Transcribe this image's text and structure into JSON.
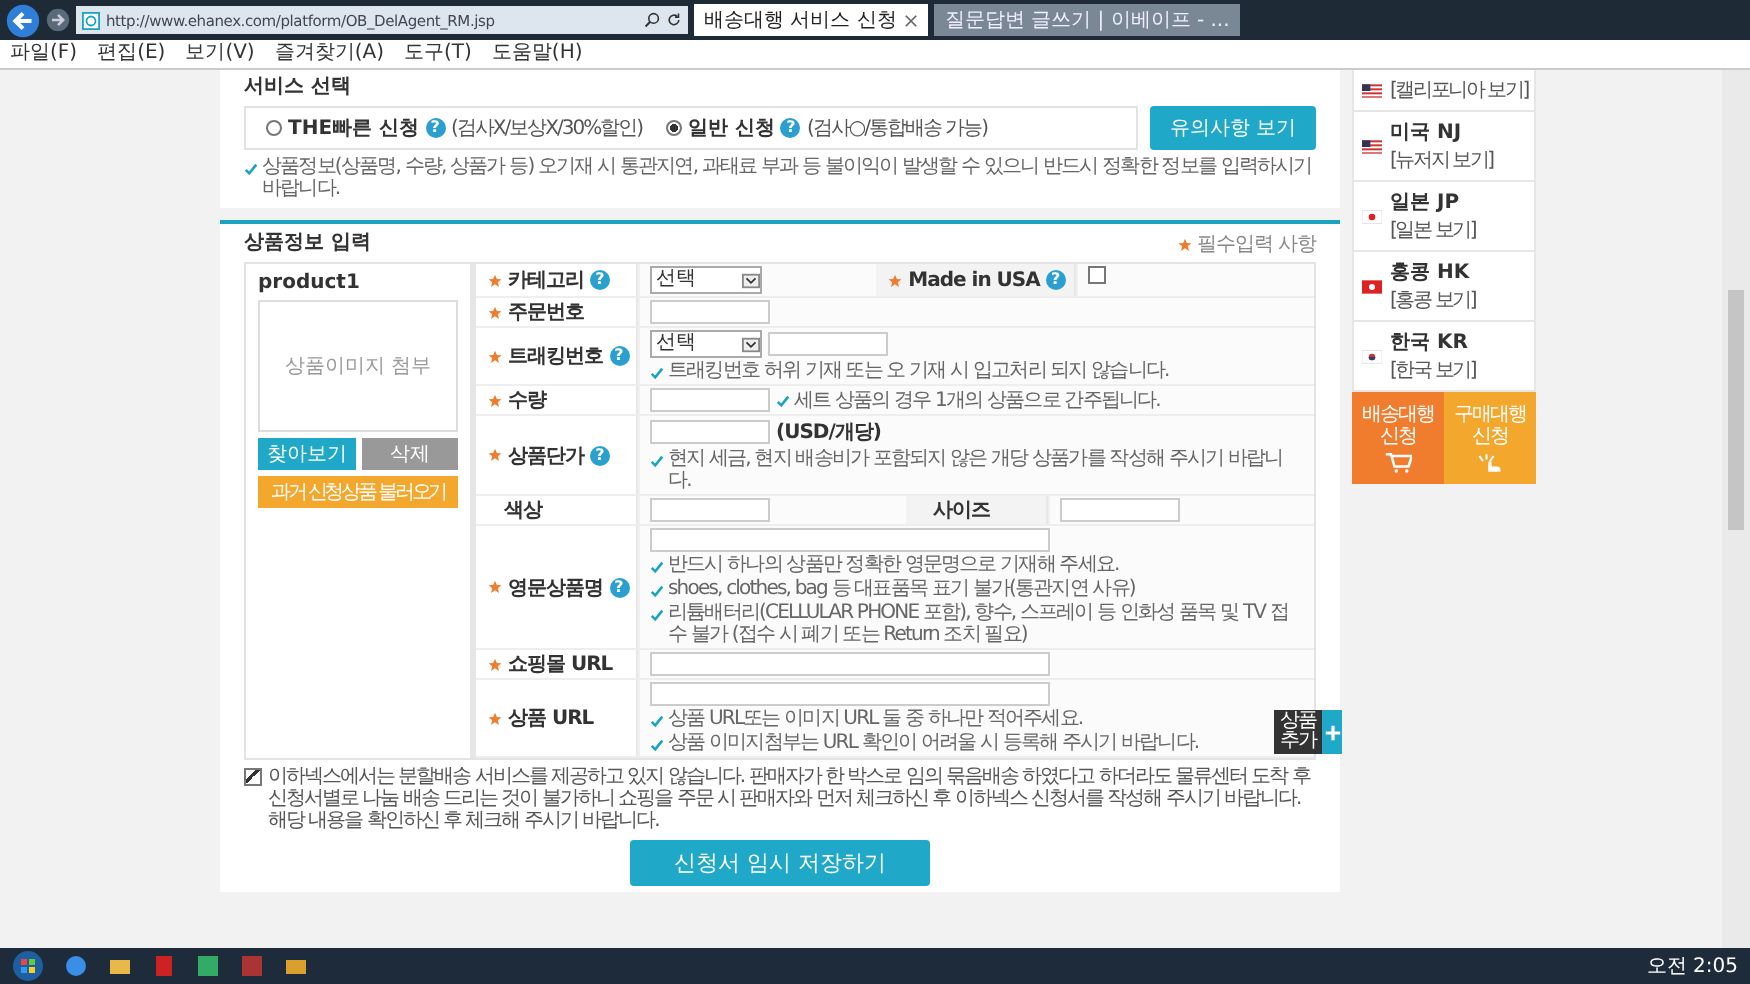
{
  "browser": {
    "address": "http://www.ehanex.com/platform/OB_DelAgent_RM.jsp",
    "tabs": [
      {
        "label": "배송대행 서비스 신청",
        "selected": true
      },
      {
        "label": "질문답변 글쓰기 | 이베이프 - ...",
        "selected": false
      }
    ],
    "menu": [
      "파일(F)",
      "편집(E)",
      "보기(V)",
      "즐겨찾기(A)",
      "도구(T)",
      "도움말(H)"
    ]
  },
  "help_glyph": "?",
  "service": {
    "title": "서비스 선택",
    "options": [
      {
        "label": "THE빠른 신청",
        "note": "(검사X/보상X/30%할인)",
        "selected": false
      },
      {
        "label": "일반 신청",
        "note": "(검사○/통합배송 가능)",
        "selected": true
      }
    ],
    "button": "유의사항 보기",
    "notice": "상품정보(상품명, 수량, 상품가 등) 오기재 시 통관지연, 과태료 부과 등 불이익이 발생할 수 있으니 반드시 정확한 정보를 입력하시기 바랍니다."
  },
  "product_section": {
    "title": "상품정보 입력",
    "required_legend": "필수입력 사항",
    "product": {
      "name": "product1",
      "image_placeholder": "상품이미지 첨부",
      "image_buttons": [
        {
          "label": "찾아보기",
          "kind": "primary"
        },
        {
          "label": "삭제",
          "kind": "secondary"
        }
      ],
      "load_button": "과거 신청상품 불러오기"
    },
    "rows": [
      {
        "fields": [
          {
            "label": "카테고리",
            "required": true,
            "help": true,
            "controls": [
              {
                "kind": "select",
                "value": "선택"
              }
            ]
          },
          {
            "label": "Made in USA",
            "required": true,
            "help": true,
            "controls": [
              {
                "kind": "checkbox",
                "checked": false
              }
            ]
          }
        ]
      },
      {
        "fields": [
          {
            "label": "주문번호",
            "required": true,
            "help": false,
            "controls": [
              {
                "kind": "input"
              }
            ]
          }
        ]
      },
      {
        "fields": [
          {
            "label": "트래킹번호",
            "required": true,
            "help": true,
            "controls": [
              {
                "kind": "select",
                "value": "선택"
              },
              {
                "kind": "input"
              }
            ],
            "notes": [
              "트래킹번호 허위 기재 또는 오 기재 시 입고처리 되지 않습니다."
            ]
          }
        ]
      },
      {
        "fields": [
          {
            "label": "수량",
            "required": true,
            "help": false,
            "controls": [
              {
                "kind": "input"
              }
            ],
            "side_note": "세트 상품의 경우 1개의 상품으로 간주됩니다."
          }
        ]
      },
      {
        "fields": [
          {
            "label": "상품단가",
            "required": true,
            "help": true,
            "controls": [
              {
                "kind": "input"
              }
            ],
            "unit": "(USD/개당)",
            "notes": [
              "현지 세금, 현지 배송비가 포함되지 않은 개당 상품가를 작성해 주시기 바랍니다."
            ]
          }
        ]
      },
      {
        "fields": [
          {
            "label": "색상",
            "required": false,
            "help": false,
            "controls": [
              {
                "kind": "input"
              }
            ]
          },
          {
            "label": "사이즈",
            "required": false,
            "help": false,
            "controls": [
              {
                "kind": "input"
              }
            ]
          }
        ]
      },
      {
        "fields": [
          {
            "label": "영문상품명",
            "required": true,
            "help": true,
            "controls": [
              {
                "kind": "wide"
              }
            ],
            "notes": [
              "반드시 하나의 상품만 정확한 영문명으로 기재해 주세요.",
              "shoes, clothes, bag 등 대표품목 표기 불가(통관지연 사유)",
              "리튬배터리(CELLULAR PHONE 포함), 향수, 스프레이 등 인화성 품목 및 TV 접수 불가 (접수 시 폐기 또는 Return 조치 필요)"
            ]
          }
        ]
      },
      {
        "fields": [
          {
            "label": "쇼핑몰 URL",
            "required": true,
            "help": false,
            "controls": [
              {
                "kind": "wide"
              }
            ]
          }
        ]
      },
      {
        "fields": [
          {
            "label": "상품 URL",
            "required": true,
            "help": false,
            "controls": [
              {
                "kind": "wide"
              }
            ],
            "notes": [
              "상품 URL또는 이미지 URL 둘 중 하나만 적어주세요.",
              "상품 이미지첨부는 URL 확인이 어려울 시 등록해 주시기 바랍니다."
            ]
          }
        ]
      }
    ],
    "add_button": "상품 추가"
  },
  "agreement": {
    "checked": true,
    "text": "이하넥스에서는 분할배송 서비스를 제공하고 있지 않습니다. 판매자가 한 박스로 임의 묶음배송 하였다고 하더라도 물류센터 도착 후 신청서별로 나눔 배송 드리는 것이 불가하니 쇼핑을 주문 시 판매자와 먼저 체크하신 후 이하넥스 신청서를 작성해 주시기 바랍니다.",
    "subtext": "해당 내용을 확인하신 후 체크해 주시기 바랍니다."
  },
  "save_button": "신청서 임시 저장하기",
  "sidebar": {
    "regions": [
      {
        "kind": "us",
        "link": "[캘리포니아 보기]"
      },
      {
        "kind": "us",
        "name": "미국 NJ",
        "link": "[뉴저지 보기]"
      },
      {
        "kind": "jp",
        "name": "일본 JP",
        "link": "[일본 보기]"
      },
      {
        "kind": "hk",
        "name": "홍콩 HK",
        "link": "[홍콩 보기]"
      },
      {
        "kind": "kr",
        "name": "한국 KR",
        "link": "[한국 보기]"
      }
    ],
    "tiles": [
      {
        "kind": "cart",
        "label": "배송대행 신청",
        "color": "#f07d2e"
      },
      {
        "kind": "tap",
        "label": "구매대행 신청",
        "color": "#f3a72c"
      }
    ]
  },
  "taskbar": {
    "time": "오전 2:05"
  }
}
